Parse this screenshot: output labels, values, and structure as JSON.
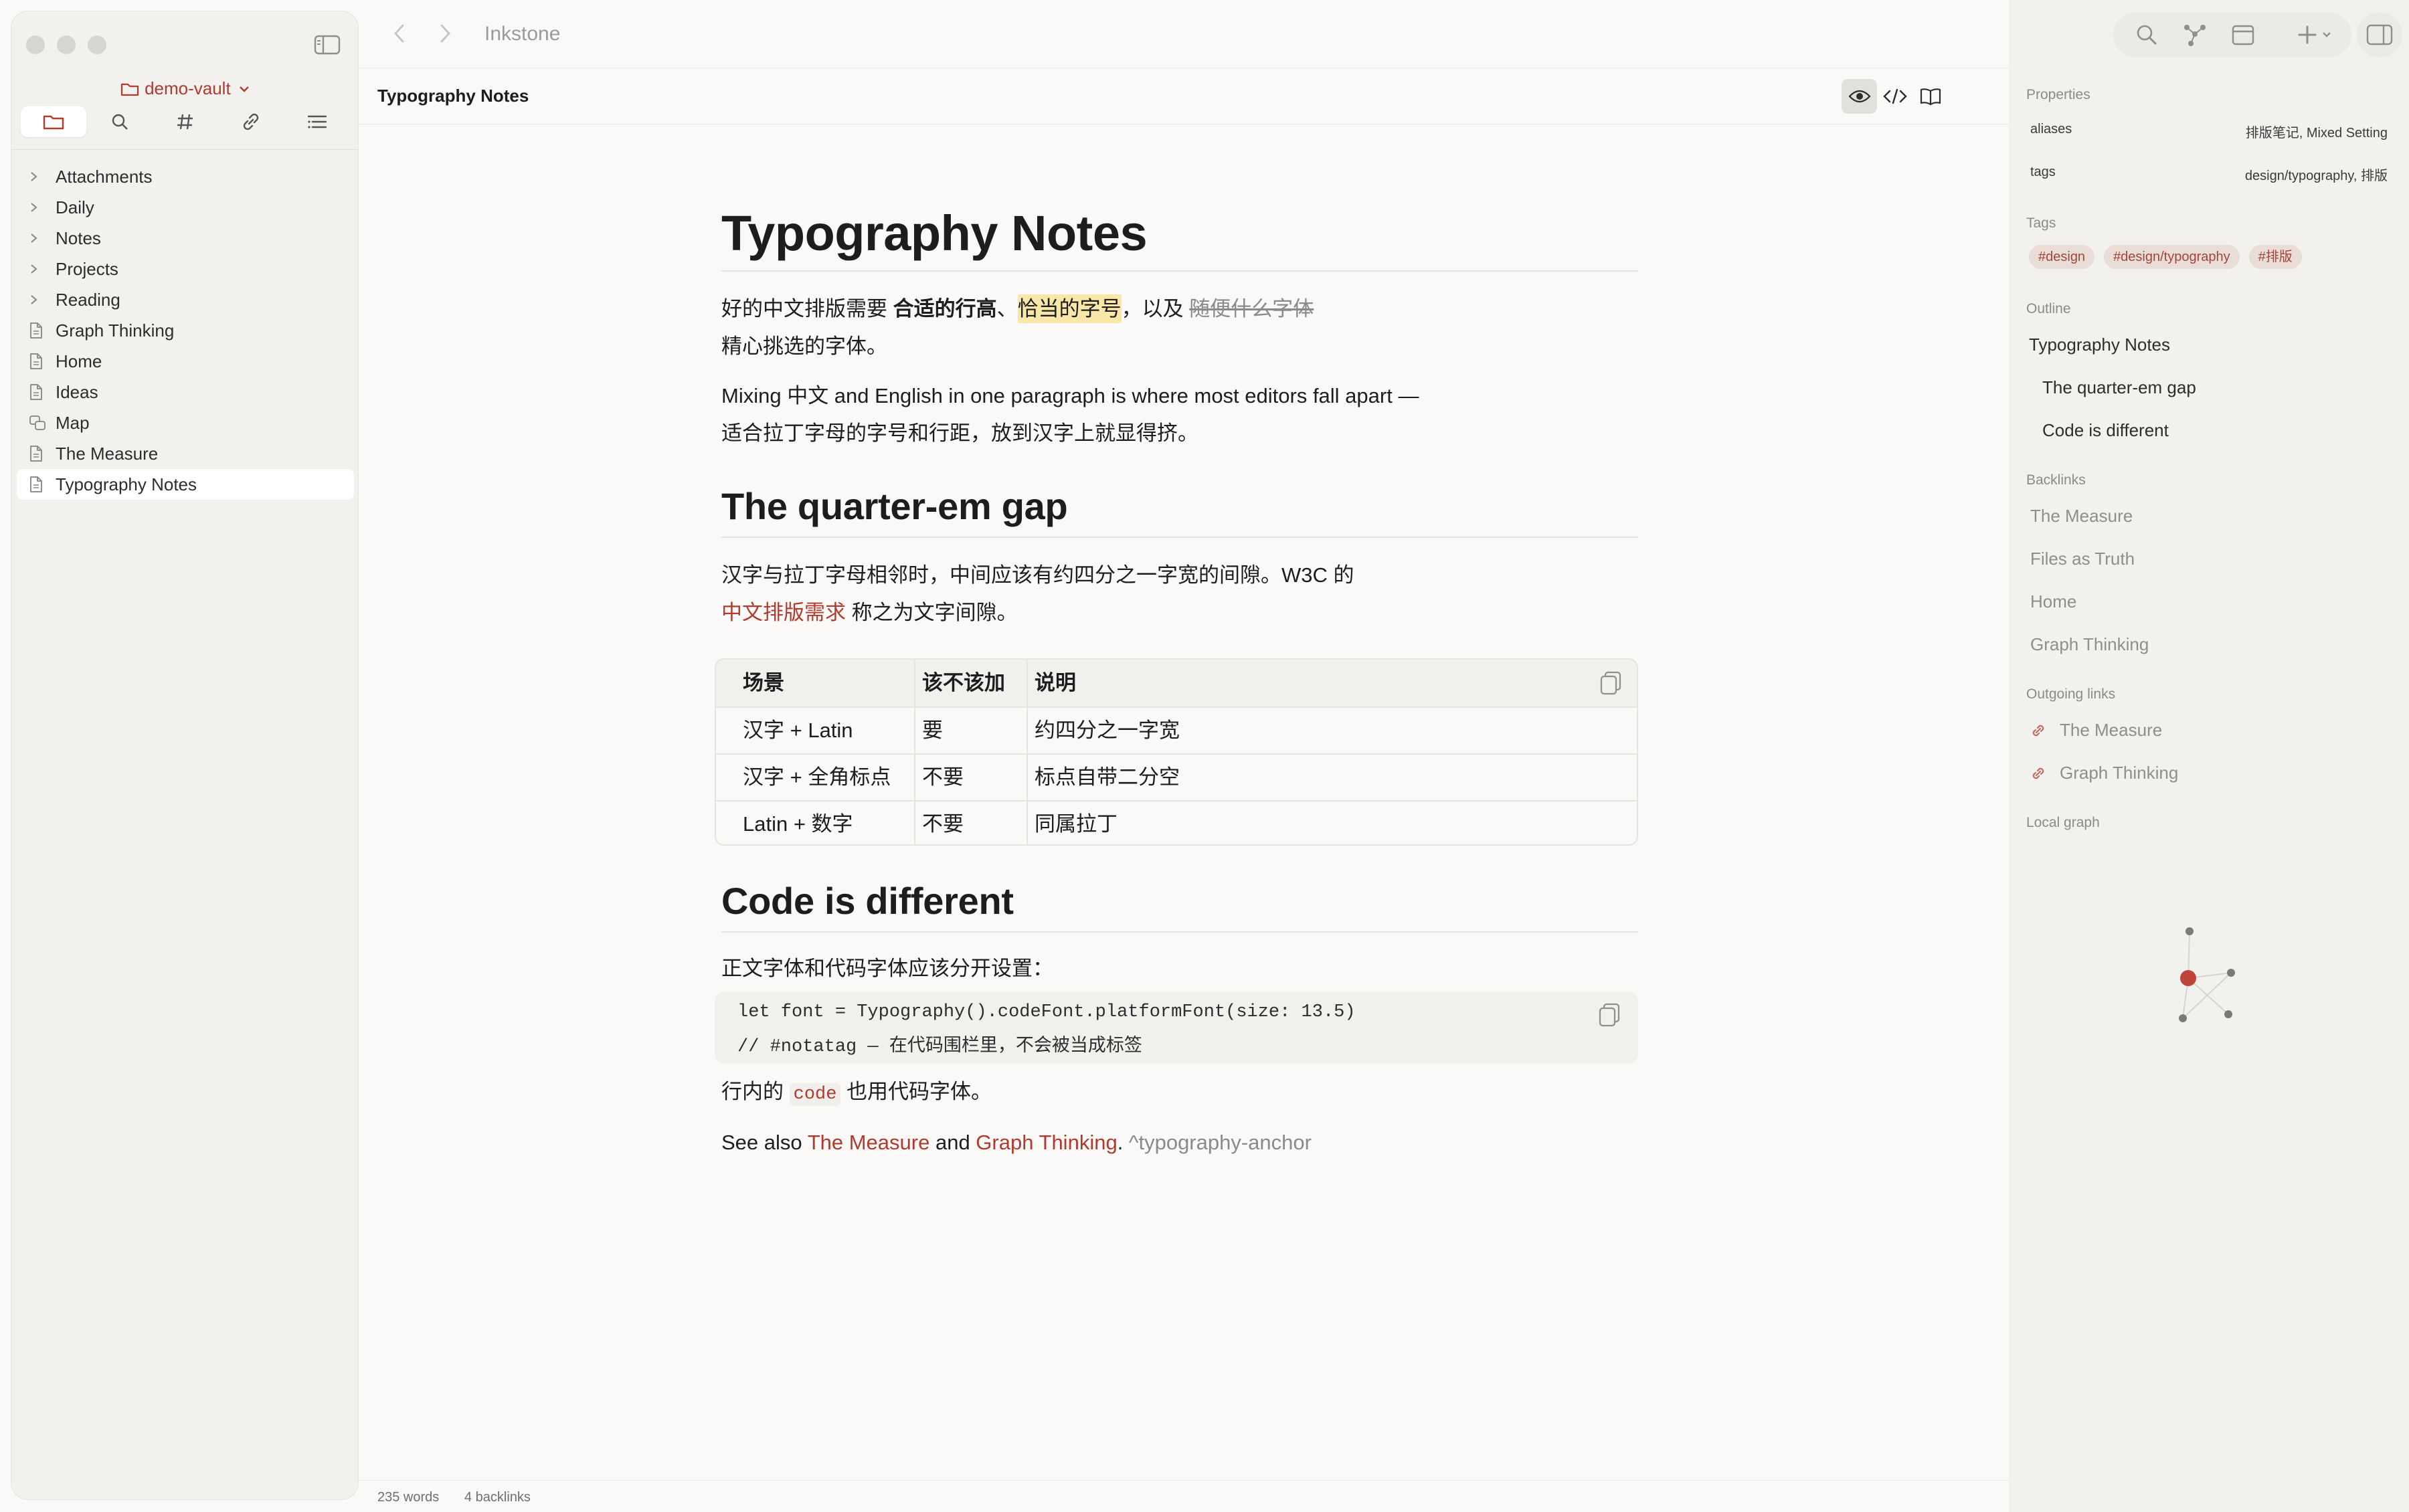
{
  "app": {
    "title": "Inkstone"
  },
  "sidebar": {
    "vault_name": "demo-vault",
    "tabs": [
      "files",
      "search",
      "tags",
      "links",
      "outline"
    ],
    "items": [
      {
        "label": "Attachments",
        "kind": "folder"
      },
      {
        "label": "Daily",
        "kind": "folder"
      },
      {
        "label": "Notes",
        "kind": "folder"
      },
      {
        "label": "Projects",
        "kind": "folder"
      },
      {
        "label": "Reading",
        "kind": "folder"
      },
      {
        "label": "Graph Thinking",
        "kind": "file"
      },
      {
        "label": "Home",
        "kind": "file"
      },
      {
        "label": "Ideas",
        "kind": "file"
      },
      {
        "label": "Map",
        "kind": "canvas"
      },
      {
        "label": "The Measure",
        "kind": "file"
      },
      {
        "label": "Typography Notes",
        "kind": "file",
        "selected": true
      }
    ]
  },
  "note": {
    "title": "Typography Notes",
    "h1": "Typography Notes",
    "p1": {
      "t1": "好的中文排版需要 ",
      "bold": "合适的行高",
      "t2": "、",
      "highlight": "恰当的字号",
      "t3": "，以及 ",
      "strike": "随便什么字体",
      "line2": "精心挑选的字体。"
    },
    "p2": {
      "line1": "Mixing 中文 and English in one paragraph is where most editors fall apart —",
      "line2": "适合拉丁字母的字号和行距，放到汉字上就显得挤。"
    },
    "h2_1": "The quarter-em gap",
    "p3": {
      "line1": "汉字与拉丁字母相邻时，中间应该有约四分之一字宽的间隙。W3C 的",
      "link": "中文排版需求",
      "rest": " 称之为文字间隙。"
    },
    "table": {
      "headers": [
        "场景",
        "该不该加",
        "说明"
      ],
      "rows": [
        [
          "汉字 + Latin",
          "要",
          "约四分之一字宽"
        ],
        [
          "汉字 + 全角标点",
          "不要",
          "标点自带二分空"
        ],
        [
          "Latin + 数字",
          "不要",
          "同属拉丁"
        ]
      ]
    },
    "h2_2": "Code is different",
    "p4": "正文字体和代码字体应该分开设置：",
    "code": [
      "let font = Typography().codeFont.platformFont(size: 13.5)",
      "// #notatag — 在代码围栏里，不会被当成标签"
    ],
    "p5": {
      "t1": "行内的 ",
      "code": "code",
      "t2": " 也用代码字体。"
    },
    "p6": {
      "t1": "See also ",
      "link1": "The Measure",
      "t2": " and ",
      "link2": "Graph Thinking",
      "t3": ". ",
      "anchor": "^typography-anchor"
    }
  },
  "status": {
    "words": "235 words",
    "backlinks": "4 backlinks"
  },
  "panel": {
    "properties_label": "Properties",
    "properties": [
      {
        "key": "aliases",
        "value": "排版笔记, Mixed Setting"
      },
      {
        "key": "tags",
        "value": "design/typography, 排版"
      }
    ],
    "tags_label": "Tags",
    "tags": [
      "#design",
      "#design/typography",
      "#排版"
    ],
    "outline_label": "Outline",
    "outline": [
      "Typography Notes",
      "The quarter-em gap",
      "Code is different"
    ],
    "backlinks_label": "Backlinks",
    "backlinks": [
      "The Measure",
      "Files as Truth",
      "Home",
      "Graph Thinking"
    ],
    "outgoing_label": "Outgoing links",
    "outgoing": [
      "The Measure",
      "Graph Thinking"
    ],
    "local_graph_label": "Local graph"
  },
  "colors": {
    "accent": "#b03a2e",
    "highlight": "#f8e7a6",
    "tag_bg": "#eadcd6"
  }
}
